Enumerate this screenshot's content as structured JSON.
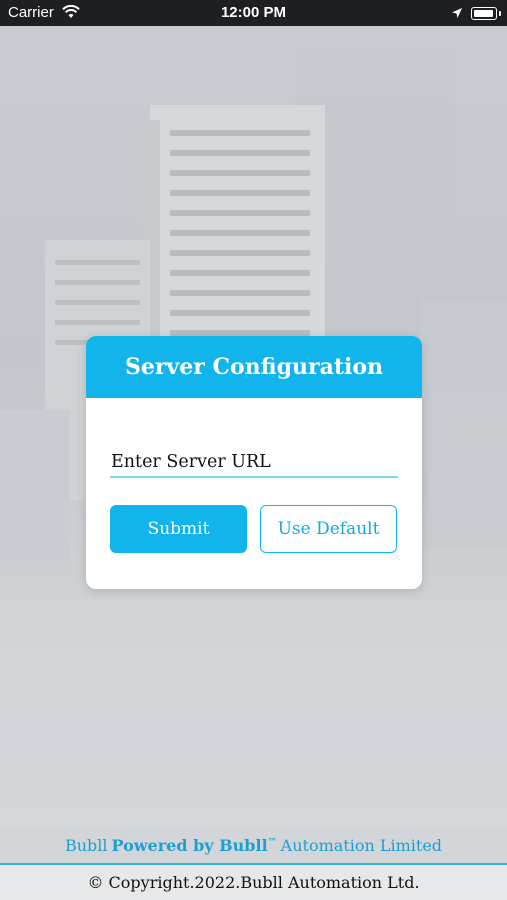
{
  "status_bar": {
    "carrier": "Carrier",
    "time": "12:00 PM"
  },
  "dialog": {
    "title": "Server Configuration",
    "url_input": {
      "placeholder": "Enter Server URL",
      "value": ""
    },
    "submit_label": "Submit",
    "default_label": "Use Default"
  },
  "footer": {
    "brand": "Bubll",
    "powered_by": "Powered by Bubll",
    "trademark": "™",
    "company": "Automation Limited",
    "copyright": "© Copyright.2022.Bubll Automation Ltd."
  },
  "colors": {
    "accent": "#12b4ec",
    "footer_text": "#1d9fd3"
  },
  "icons": [
    "wifi-icon",
    "location-arrow-icon",
    "battery-icon"
  ]
}
